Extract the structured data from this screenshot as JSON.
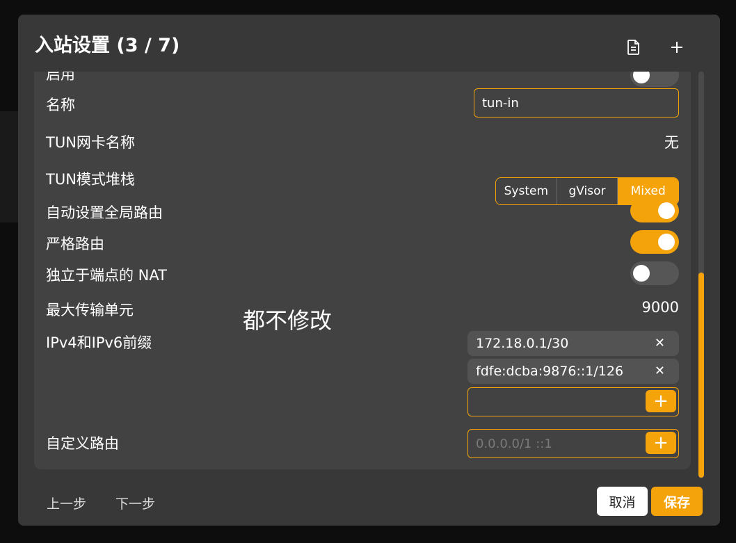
{
  "dialog": {
    "title": "入站设置 (3 / 7)",
    "header_icons": [
      "document-icon",
      "plus-icon"
    ]
  },
  "form": {
    "enable": {
      "label": "启用",
      "value": false
    },
    "name": {
      "label": "名称",
      "value": "tun-in"
    },
    "tun_device": {
      "label": "TUN网卡名称",
      "value": "无"
    },
    "tun_stack": {
      "label": "TUN模式堆栈",
      "options": [
        "System",
        "gVisor",
        "Mixed"
      ],
      "selected": "Mixed"
    },
    "auto_route": {
      "label": "自动设置全局路由",
      "value": true
    },
    "strict_route": {
      "label": "严格路由",
      "value": true
    },
    "endpoint_independent_nat": {
      "label": "独立于端点的 NAT",
      "value": false
    },
    "mtu": {
      "label": "最大传输单元",
      "value": "9000"
    },
    "prefixes": {
      "label": "IPv4和IPv6前缀",
      "items": [
        "172.18.0.1/30",
        "fdfe:dcba:9876::1/126"
      ],
      "new_value": ""
    },
    "custom_route": {
      "label": "自定义路由",
      "placeholder": "0.0.0.0/1 ::1"
    }
  },
  "overlay_text": "都不修改",
  "footer": {
    "prev_label": "上一步",
    "next_label": "下一步",
    "cancel_label": "取消",
    "save_label": "保存"
  },
  "colors": {
    "accent": "#f5a30a",
    "dialog_bg": "#383838",
    "panel_bg": "#424242"
  }
}
